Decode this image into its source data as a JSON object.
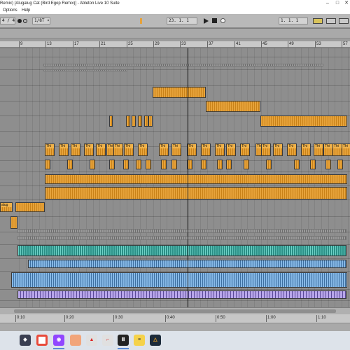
{
  "window": {
    "title": "Remix) [Alugalug Cat (Bird Egop Remix)] - Ableton Live 10 Suite"
  },
  "menu": {
    "items": [
      "Options",
      "Help"
    ]
  },
  "controlbar": {
    "meter": "4 / 4",
    "quantize": "1/8T",
    "position": "23.  1.  1",
    "loop_start": "1.  1.  1",
    "record_state": "idle"
  },
  "ruler": {
    "bars": [
      "9",
      "13",
      "17",
      "21",
      "25",
      "29",
      "33",
      "37",
      "41",
      "45",
      "49",
      "53",
      "57"
    ]
  },
  "time_ruler": {
    "labels": [
      "0:10",
      "0:20",
      "0:30",
      "0:40",
      "0:50",
      "1:00",
      "1:10"
    ]
  },
  "clips": {
    "track1_label": "Thi",
    "track_label_left": "alug"
  },
  "taskbar": {
    "icons": [
      "gaming-app-icon",
      "chrome-icon",
      "twitch-icon",
      "photo-app-icon",
      "pdf-icon",
      "pdf-reader-icon",
      "live-icon",
      "notes-icon",
      "sibelius-icon"
    ]
  },
  "colors": {
    "audio_clip": "#e6a23a",
    "midi_teal": "#6fd3c8",
    "midi_blue": "#86b8e6",
    "midi_purple": "#b8a6ea",
    "arrangement_bg": "#8e8e8e"
  }
}
